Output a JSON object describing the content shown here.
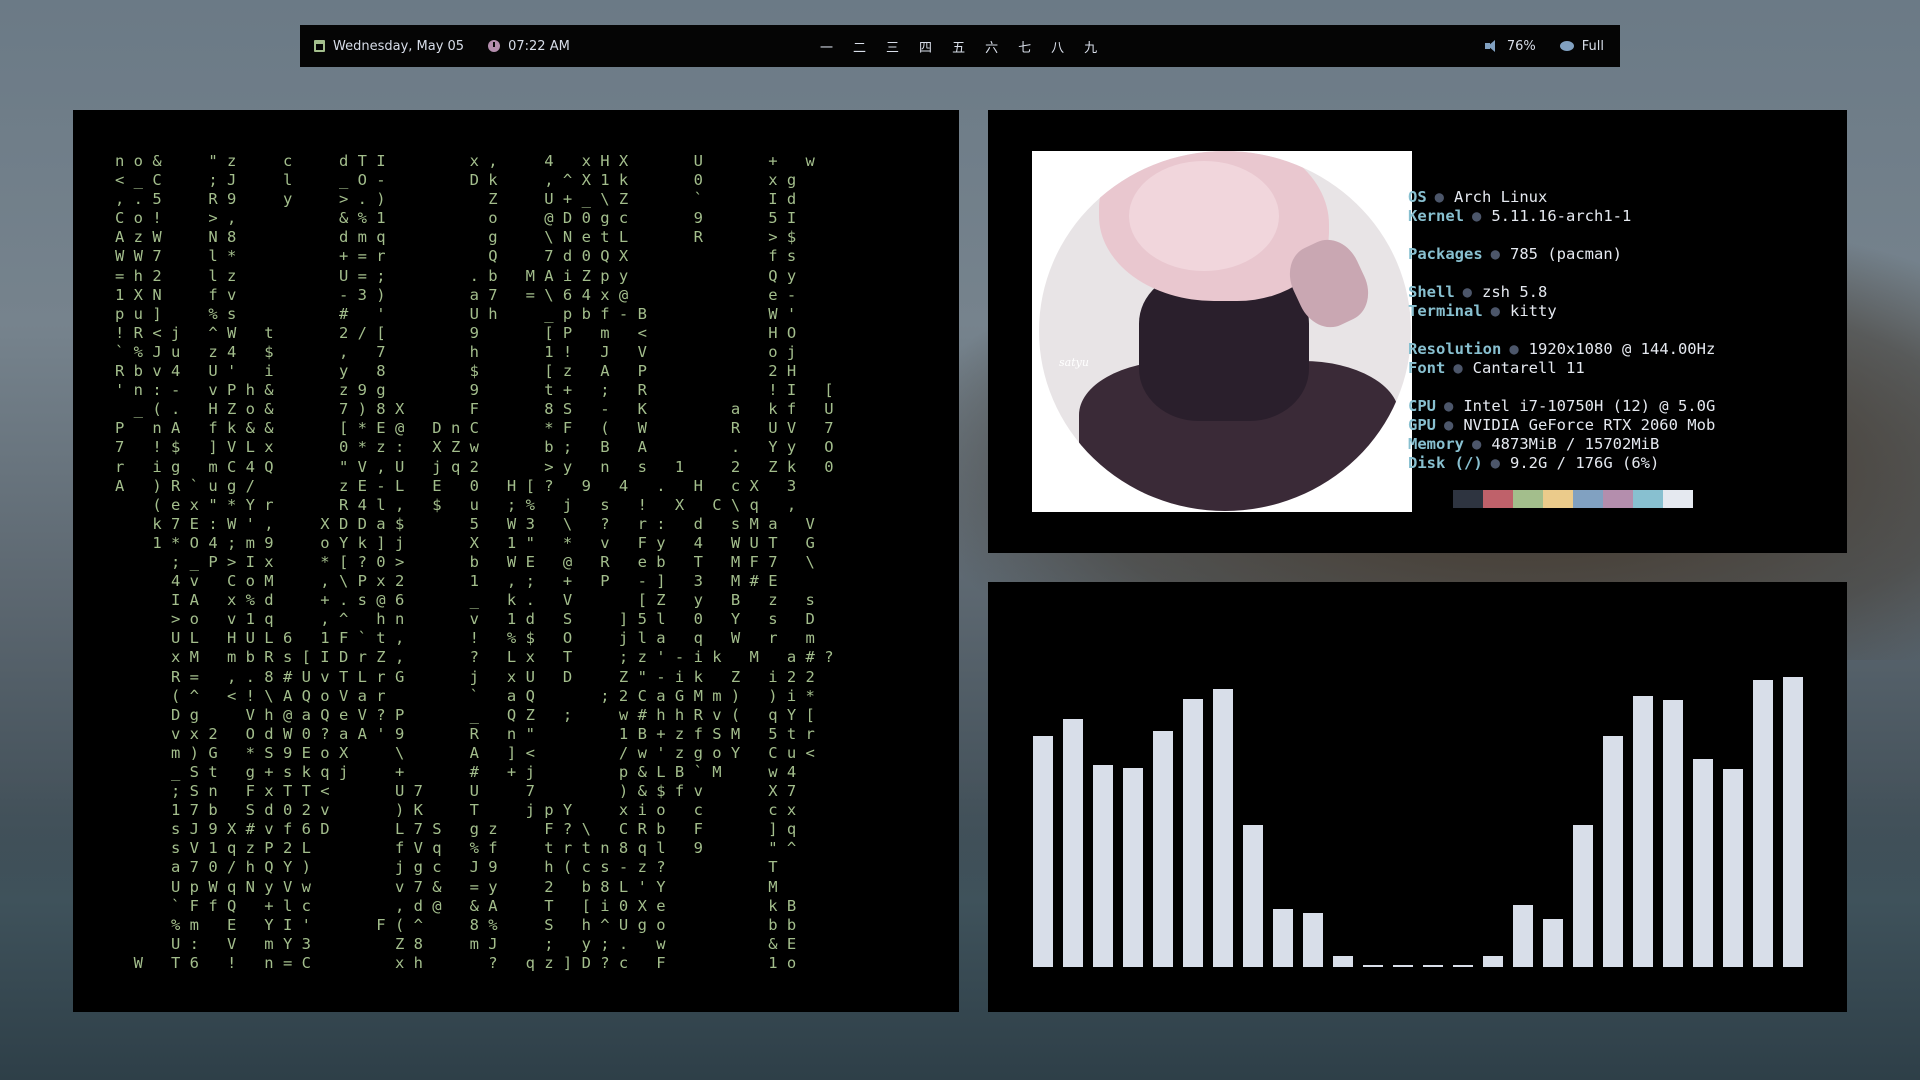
{
  "topbar": {
    "date": "Wednesday, May 05",
    "time": "07:22 AM",
    "workspaces": [
      "一",
      "二",
      "三",
      "四",
      "五",
      "六",
      "七",
      "八",
      "九"
    ],
    "volume": "76%",
    "battery": "Full",
    "icons": {
      "date": "calendar-icon",
      "time": "clock-icon",
      "volume": "speaker-icon",
      "battery": "battery-icon"
    }
  },
  "matrix": {
    "lines": [
      "n o &     \" z     c     d T I         x ,     4   x H X       U       +   w",
      "< _ C     ; J     l     _ O -         D k     , ^ X 1 k       0       x g",
      ", . 5     R 9     y     > . )           Z     U + _ \\ Z       `       I d",
      "C o !     > ,           & % 1           o     @ D 0 g c       9       5 I",
      "A z W     N 8           d m q           g     \\ N e t L       R       > $",
      "W W 7     l *           + = r           Q     7 d 0 Q X               f s",
      "= h 2     l z           U = ;         . b   M A i Z p y               Q y",
      "1 X N     f v           - 3 )         a 7   = \\ 6 4 x @               e -",
      "p u ]     % s           #   '         U h     _ p b f - B             W '",
      "! R < j   ^ W   t       2 / [         9       [ P   m   <             H O",
      "` % J u   z 4   $       ,   7         h       1 !   J   V             o j",
      "R b v 4   U '   i       y   8         $       [ z   A   P             2 H",
      "' n : -   v P h &       z 9 g         9       t +   ;   R             ! I   [",
      "  _ ( .   H Z o &       7 ) 8 X       F       8 S   -   K         a   k f   U",
      "P   n A   f k & &       [ * E @   D n C       * F   (   W         R   U V   7",
      "7   ! $   ] V L x       0 * z :   X Z w       b ;   B   A         .   Y y   O",
      "r   i g   m C 4 Q       \" V , U   j q 2       > y   n   s   1     2   Z k   0",
      "A   ) R ` u g /         z E - L   E   0   H [ ?   9   4   .   H   c X   3",
      "    ( e x \" * Y r       R 4 l ,   $   u   ; %   j   s   !   X   C \\ q   ,",
      "    k 7 E : W ' ,     X D D a $       5   W 3   \\   ?   r :   d   s M a   V",
      "    1 * O 4 ; m 9     o Y k ] j       X   1 \"   *   v   F y   4   W U T   G",
      "      ; _ P > I x     * [ ? 0 >       b   W E   @   R   e b   T   M F 7   \\",
      "      4 v   C o M     , \\ P x 2       1   , ;   +   P   - ]   3   M # E",
      "      I A   x % d     + . s @ 6       _   k .   V       [ Z   y   B   z   s",
      "      > o   v 1 q     , ^   h n       v   1 d   S     ] 5 l   0   Y   s   D",
      "      U L   H U L 6   1 F ` t ,       !   % $   O     j l a   q   W   r   m",
      "      x M   m b R s [ I D r Z ,       ?   L x   T     ; z ' - i k   M   a # ?",
      "      R =   , . 8 # U v T L r G       j   x U   D     Z \" - i k   Z   i 2 2",
      "      ( ^   < ! \\ A Q o V a r         `   a Q       ; 2 C a G M m )   ) i *",
      "      D g     V h @ a Q e V ? P       _   Q Z   ;     w # h h R v (   q Y [",
      "      v x 2   O d W 0 ? a A ' 9       R   n \"         1 B + z f S M   5 t r",
      "      m ) G   * S 9 E o X     \\       A   ] <         / w ' z g o Y   C u <",
      "      _ S t   g + s k q j     +       #   + j         p & L B ` M     w 4",
      "      ; S n   F x T T <       U 7     U     7         ) & $ f v       X 7",
      "      1 7 b   S d 0 2 v       ) K     T     j p Y     x i o   c       c x",
      "      s J 9 X # v f 6 D       L 7 S   g z     F ? \\   C R b   F       ] q",
      "      s V 1 q z P 2 L         f V q   % f     t r t n 8 q l   9       \" ^",
      "      a 7 0 / h Q Y )         j g c   J 9     h ( c s - z ?           T",
      "      U p W q N y V w         v 7 &   = y     2   b 8 L ' Y           M",
      "      ` F f Q   + l c         , d @   & A     T   [ i 0 X e           k B",
      "      % m   E   Y I '       F ( ^     8 %     S   h ^ U g o           b b",
      "      U :   V   m Y 3         Z 8     m J     ;   y ; .   w           & E",
      "  W   T 6   !   n = C         x h       ?   q z ] D ? c   F           1 o"
    ]
  },
  "fetch": {
    "image_label": "satyu",
    "info": [
      {
        "key": "OS",
        "value": "Arch Linux"
      },
      {
        "key": "Kernel",
        "value": "5.11.16-arch1-1"
      },
      {
        "key": "",
        "value": ""
      },
      {
        "key": "Packages",
        "value": "785 (pacman)"
      },
      {
        "key": "",
        "value": ""
      },
      {
        "key": "Shell",
        "value": "zsh 5.8"
      },
      {
        "key": "Terminal",
        "value": "kitty"
      },
      {
        "key": "",
        "value": ""
      },
      {
        "key": "Resolution",
        "value": "1920x1080 @ 144.00Hz"
      },
      {
        "key": "Font",
        "value": "Cantarell 11"
      },
      {
        "key": "",
        "value": ""
      },
      {
        "key": "CPU",
        "value": "Intel i7-10750H (12) @ 5.0G"
      },
      {
        "key": "GPU",
        "value": "NVIDIA GeForce RTX 2060 Mob"
      },
      {
        "key": "Memory",
        "value": "4873MiB / 15702MiB"
      },
      {
        "key": "Disk (/)",
        "value": "9.2G / 176G (6%)"
      }
    ],
    "palette": [
      "#2e3440",
      "#bf616a",
      "#a3be8c",
      "#ebcb8b",
      "#81a1c1",
      "#b48ead",
      "#88c0d0",
      "#e5e9f0"
    ]
  },
  "cava": {
    "levels": [
      0.795,
      0.854,
      0.698,
      0.685,
      0.813,
      0.923,
      0.957,
      0.49,
      0.2,
      0.186,
      0.039,
      0.008,
      0.008,
      0.008,
      0.008,
      0.039,
      0.213,
      0.167,
      0.49,
      0.796,
      0.936,
      0.919,
      0.718,
      0.683,
      0.988,
      1.0
    ]
  }
}
